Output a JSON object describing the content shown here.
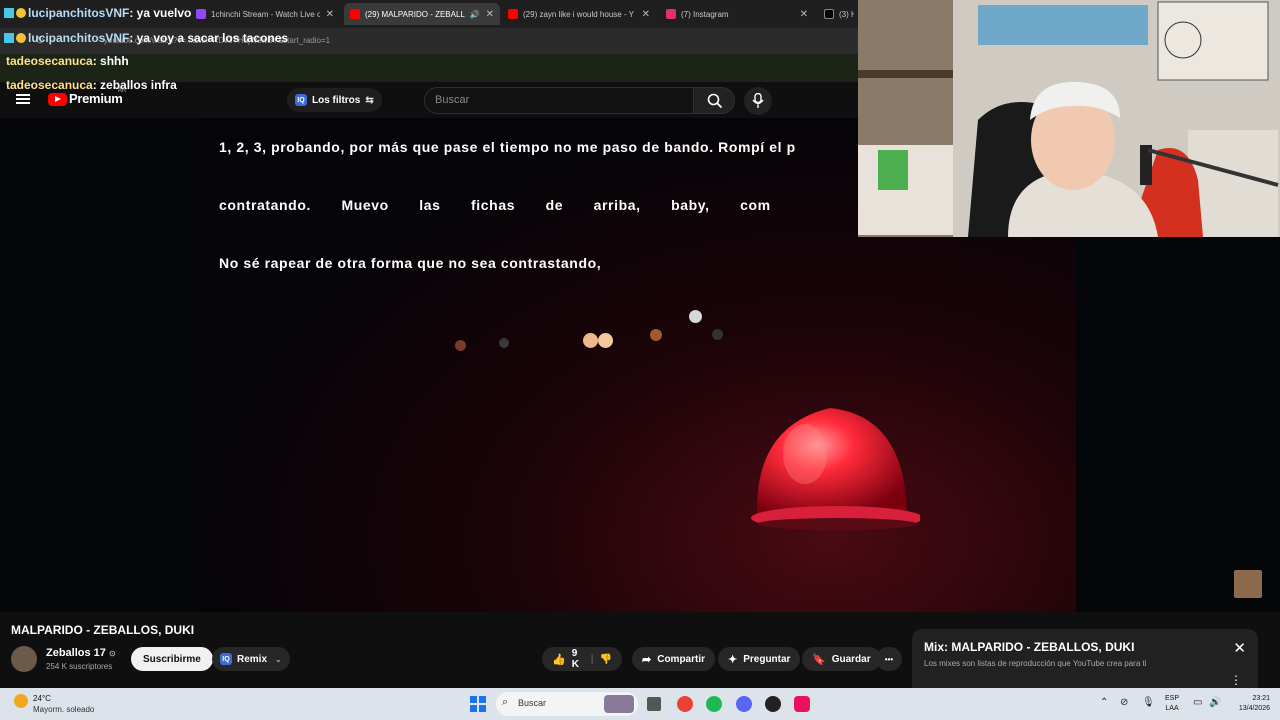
{
  "browser": {
    "tabs": [
      {
        "label": "1chinchi Stream - Watch Live o",
        "color": "#9146ff",
        "active": false
      },
      {
        "label": "(29) MALPARIDO - ZEBALL",
        "color": "#ff0000",
        "active": true,
        "audio": "🔊"
      },
      {
        "label": "(29) zayn like i would house - Y",
        "color": "#ff0000",
        "active": false
      },
      {
        "label": "(7) Instagram",
        "color": "#e1306c",
        "active": false
      },
      {
        "label": "(3) Ho",
        "color": "#000000",
        "active": false
      }
    ],
    "close_glyph": "✕",
    "url": "youtube.com/watch?v=...&list=RDv3YHdjWJwBY&start_radio=1"
  },
  "youtube": {
    "logo_text": "Premium",
    "region": "AR",
    "filters_label": "Los filtros",
    "filters_badge": "IQ",
    "search_placeholder": "Buscar"
  },
  "player": {
    "lyrics": [
      "1, 2, 3, probando, por más que pase el tiempo no me paso de bando. Rompí el p",
      "contratando.  Muevo  las  fichas  de  arriba,  baby,  com",
      "No sé rapear de otra forma que no sea contrastando,"
    ]
  },
  "video": {
    "title": "MALPARIDO - ZEBALLOS, DUKI",
    "channel": "Zeballos 17",
    "verified": "⊙",
    "subscribers": "254 K suscriptores",
    "subscribe_label": "Suscribirme",
    "remix_label": "Remix",
    "remix_badge": "IQ",
    "likes": "9 K",
    "share_label": "Compartir",
    "ask_label": "Preguntar",
    "save_label": "Guardar",
    "more_glyph": "•••"
  },
  "mix_panel": {
    "title": "Mix: MALPARIDO - ZEBALLOS, DUKI",
    "subtitle": "Los mixes son listas de reproducción que YouTube crea para ti",
    "close_glyph": "✕",
    "menu_glyph": "⋮"
  },
  "chat": [
    {
      "user": "lucipanchitosVNF",
      "message": ": ya vuelvo",
      "kind": "sub"
    },
    {
      "user": "lucipanchitosVNF",
      "message": ": ya voy a sacar los tacones",
      "kind": "sub"
    },
    {
      "user": "tadeosecanuca",
      "message": ": shhh",
      "kind": "plain"
    },
    {
      "user": "tadeosecanuca",
      "message": ": zeballos infra",
      "kind": "plain"
    }
  ],
  "taskbar": {
    "temperature": "24°C",
    "weather": "Mayorm. soleado",
    "search_placeholder": "Buscar",
    "language_top": "ESP",
    "language_bottom": "LAA",
    "time": "23:21",
    "date": "13/4/2026"
  }
}
